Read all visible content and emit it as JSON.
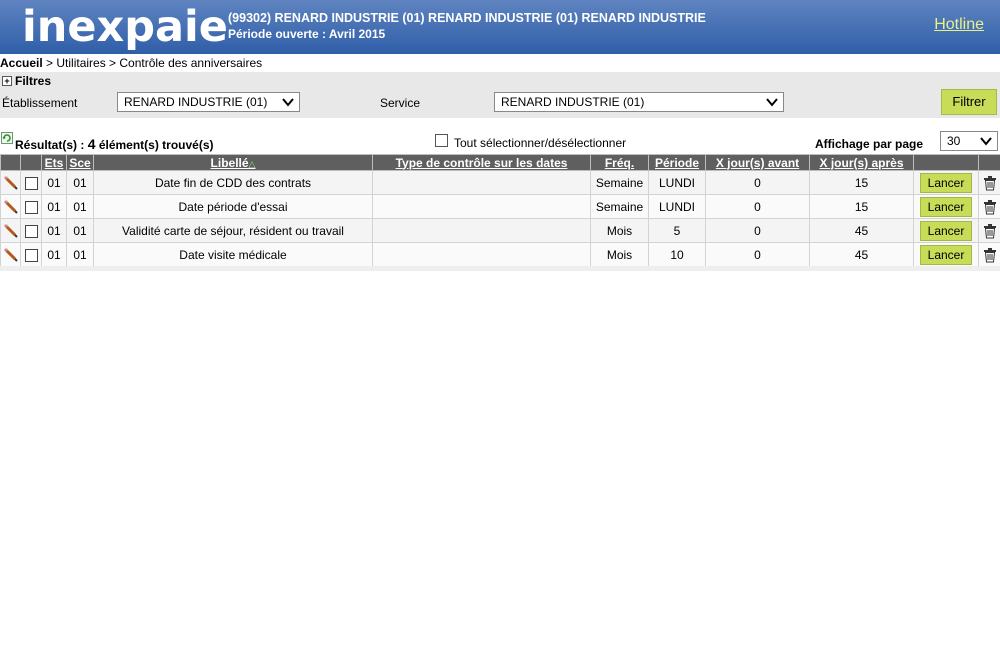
{
  "header": {
    "logo": "inexpaie",
    "company": "(99302) RENARD INDUSTRIE (01) RENARD INDUSTRIE (01) RENARD INDUSTRIE",
    "period": "Période ouverte : Avril 2015",
    "hotline": "Hotline"
  },
  "breadcrumb": {
    "first": "Accueil",
    "rest": " > Utilitaires > Contrôle des anniversaires"
  },
  "filters": {
    "title": "Filtres",
    "etablissement_label": "Établissement",
    "etablissement_value": "RENARD INDUSTRIE (01)",
    "service_label": "Service",
    "service_value": "RENARD INDUSTRIE (01)",
    "filter_button": "Filtrer"
  },
  "results": {
    "prefix": "Résultat(s) : ",
    "count": "4",
    "suffix": " élément(s) trouvé(s)",
    "select_all": "Tout sélectionner/désélectionner",
    "per_page_label": "Affichage par page",
    "per_page_value": "30"
  },
  "table": {
    "columns": {
      "ets": "Ets",
      "sce": "Sce",
      "libelle": "Libellé",
      "type": "Type de contrôle sur les dates",
      "freq": "Fréq.",
      "periode": "Période",
      "avant": "X jour(s) avant",
      "apres": "X jour(s) après"
    },
    "launch_label": "Lancer",
    "rows": [
      {
        "ets": "01",
        "sce": "01",
        "libelle": "Date fin de CDD des contrats",
        "type": "",
        "freq": "Semaine",
        "periode": "LUNDI",
        "avant": "0",
        "apres": "15"
      },
      {
        "ets": "01",
        "sce": "01",
        "libelle": "Date période d'essai",
        "type": "",
        "freq": "Semaine",
        "periode": "LUNDI",
        "avant": "0",
        "apres": "15"
      },
      {
        "ets": "01",
        "sce": "01",
        "libelle": "Validité carte de séjour, résident ou travail",
        "type": "",
        "freq": "Mois",
        "periode": "5",
        "avant": "0",
        "apres": "45"
      },
      {
        "ets": "01",
        "sce": "01",
        "libelle": "Date visite médicale",
        "type": "",
        "freq": "Mois",
        "periode": "10",
        "avant": "0",
        "apres": "45"
      }
    ]
  },
  "colors": {
    "header_blue": "#2f5ea8",
    "button_green": "#c8dc58",
    "table_header": "#5f5f5f",
    "hotline": "#e7f08a"
  },
  "icons": [
    "plus-icon",
    "chevron-down-icon",
    "refresh-icon",
    "pencil-icon",
    "trash-icon",
    "sort-asc-icon"
  ]
}
